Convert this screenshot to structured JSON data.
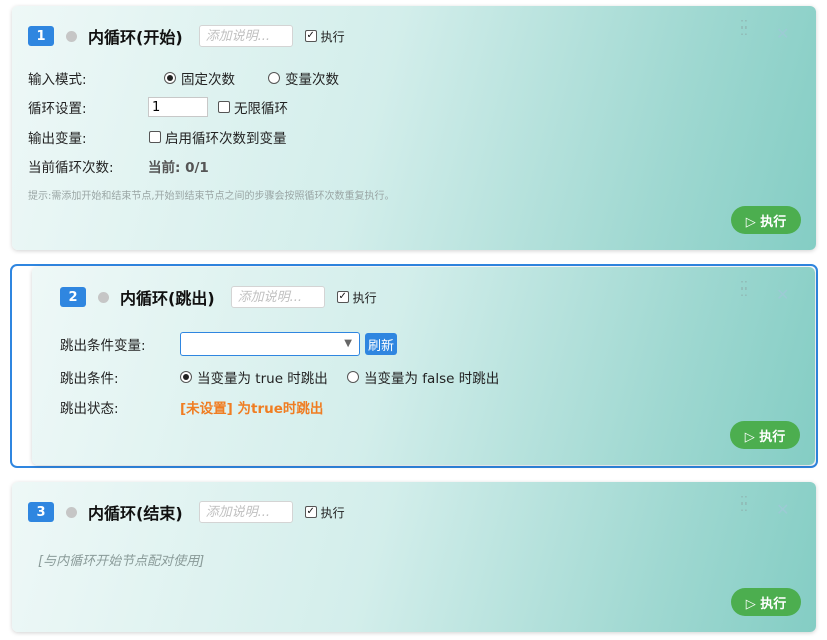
{
  "common": {
    "note_placeholder": "添加说明...",
    "exec_label": "执行",
    "run_label": "▷ 执行"
  },
  "node1": {
    "number": "1",
    "title": "内循环(开始)",
    "input_mode_label": "输入模式:",
    "input_mode_options": [
      "固定次数",
      "变量次数"
    ],
    "input_mode_selected": "固定次数",
    "loop_setting_label": "循环设置:",
    "loop_count_value": "1",
    "infinite_loop_label": "无限循环",
    "output_var_label": "输出变量:",
    "output_var_check_label": "启用循环次数到变量",
    "current_count_label": "当前循环次数:",
    "current_count_value": "当前: 0/1",
    "hint": "提示:需添加开始和结束节点,开始到结束节点之间的步骤会按照循环次数重复执行。"
  },
  "node2": {
    "number": "2",
    "title": "内循环(跳出)",
    "exit_var_label": "跳出条件变量:",
    "exit_var_value": "",
    "refresh_label": "刷新",
    "exit_cond_label": "跳出条件:",
    "exit_cond_options": [
      "当变量为 true 时跳出",
      "当变量为 false 时跳出"
    ],
    "exit_cond_selected": "当变量为 true 时跳出",
    "exit_status_label": "跳出状态:",
    "exit_status_value": "[未设置] 为true时跳出"
  },
  "node3": {
    "number": "3",
    "title": "内循环(结束)",
    "pair_note": "[与内循环开始节点配对使用]"
  },
  "colors": {
    "accent": "#2f86e0",
    "run_button": "#4cae4f",
    "warning": "#f07d22"
  }
}
